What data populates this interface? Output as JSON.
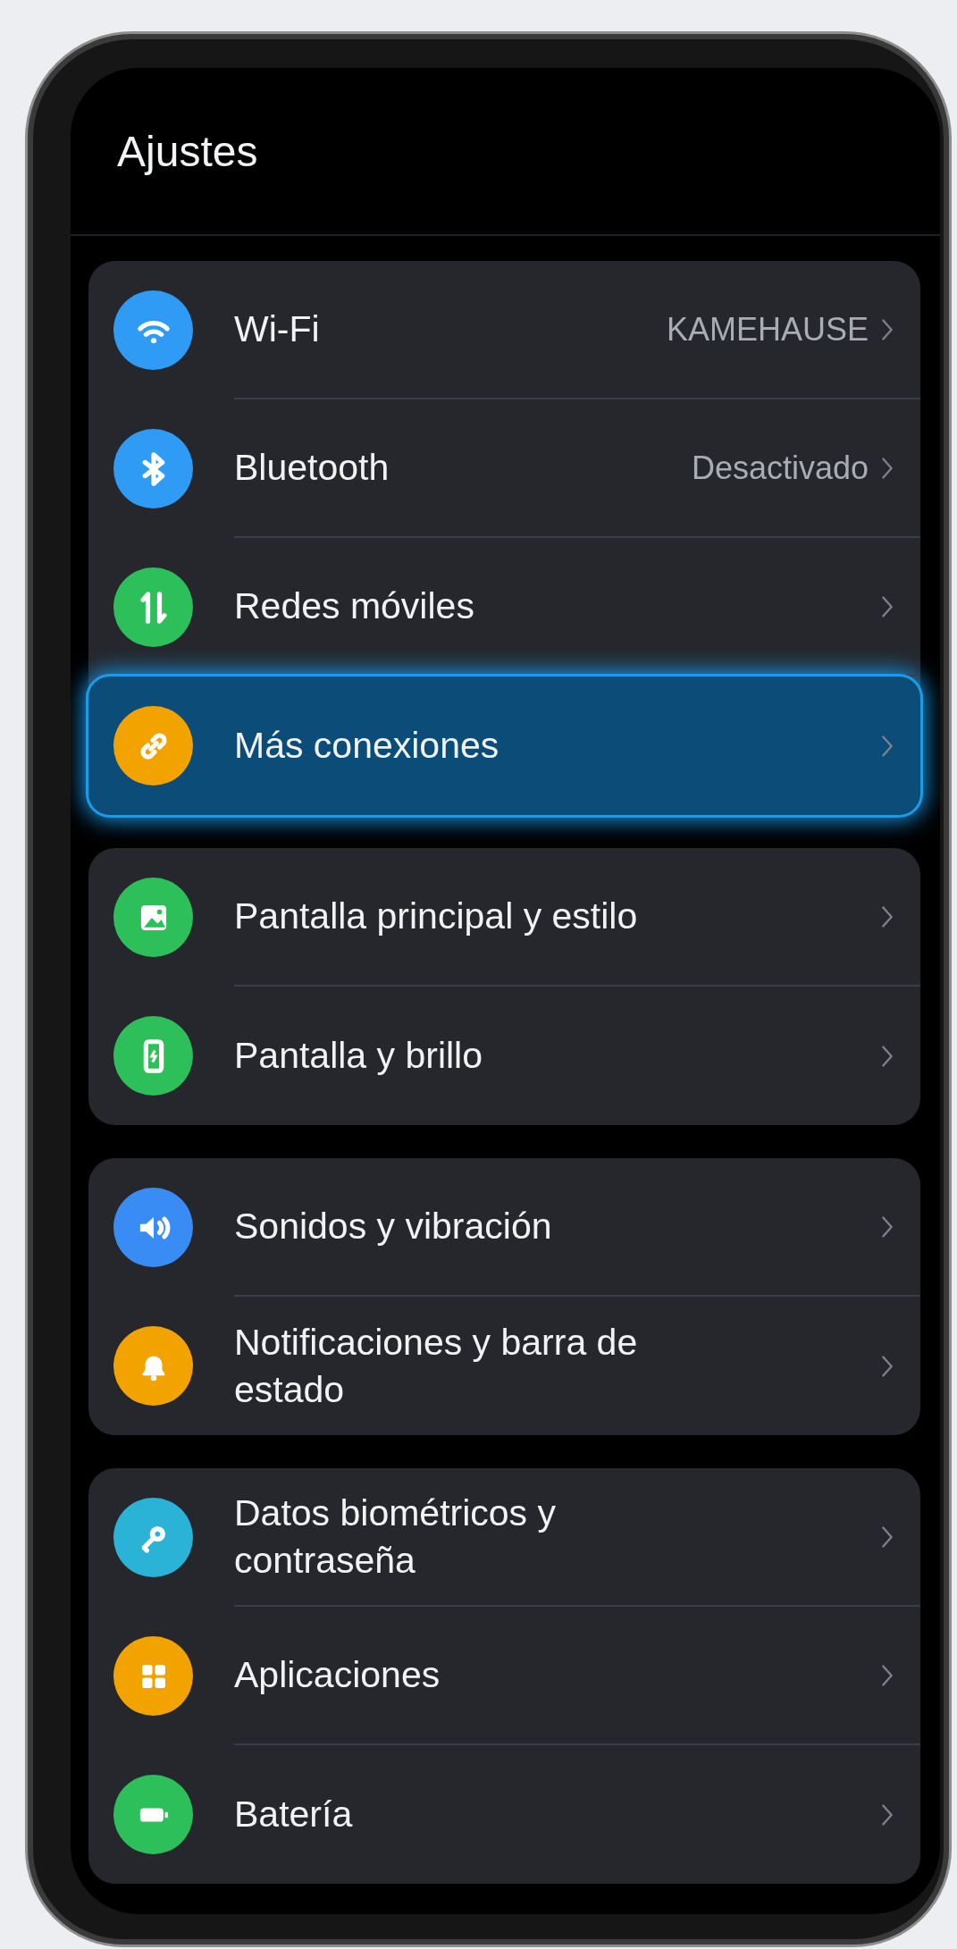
{
  "header": {
    "title": "Ajustes"
  },
  "groups": [
    {
      "items": [
        {
          "label": "Wi-Fi",
          "value": "KAMEHAUSE",
          "selected": false
        },
        {
          "label": "Bluetooth",
          "value": "Desactivado",
          "selected": false
        },
        {
          "label": "Redes móviles",
          "selected": false
        },
        {
          "label": "Más conexiones",
          "selected": true
        }
      ]
    },
    {
      "items": [
        {
          "label": "Pantalla principal y estilo",
          "selected": false
        },
        {
          "label": "Pantalla y brillo",
          "selected": false
        }
      ]
    },
    {
      "items": [
        {
          "label": "Sonidos y vibración",
          "selected": false
        },
        {
          "label": "Notificaciones y barra de estado",
          "selected": false
        }
      ]
    },
    {
      "items": [
        {
          "label": "Datos biométricos y contraseña",
          "selected": false
        },
        {
          "label": "Aplicaciones",
          "selected": false
        },
        {
          "label": "Batería",
          "selected": false
        }
      ]
    }
  ]
}
